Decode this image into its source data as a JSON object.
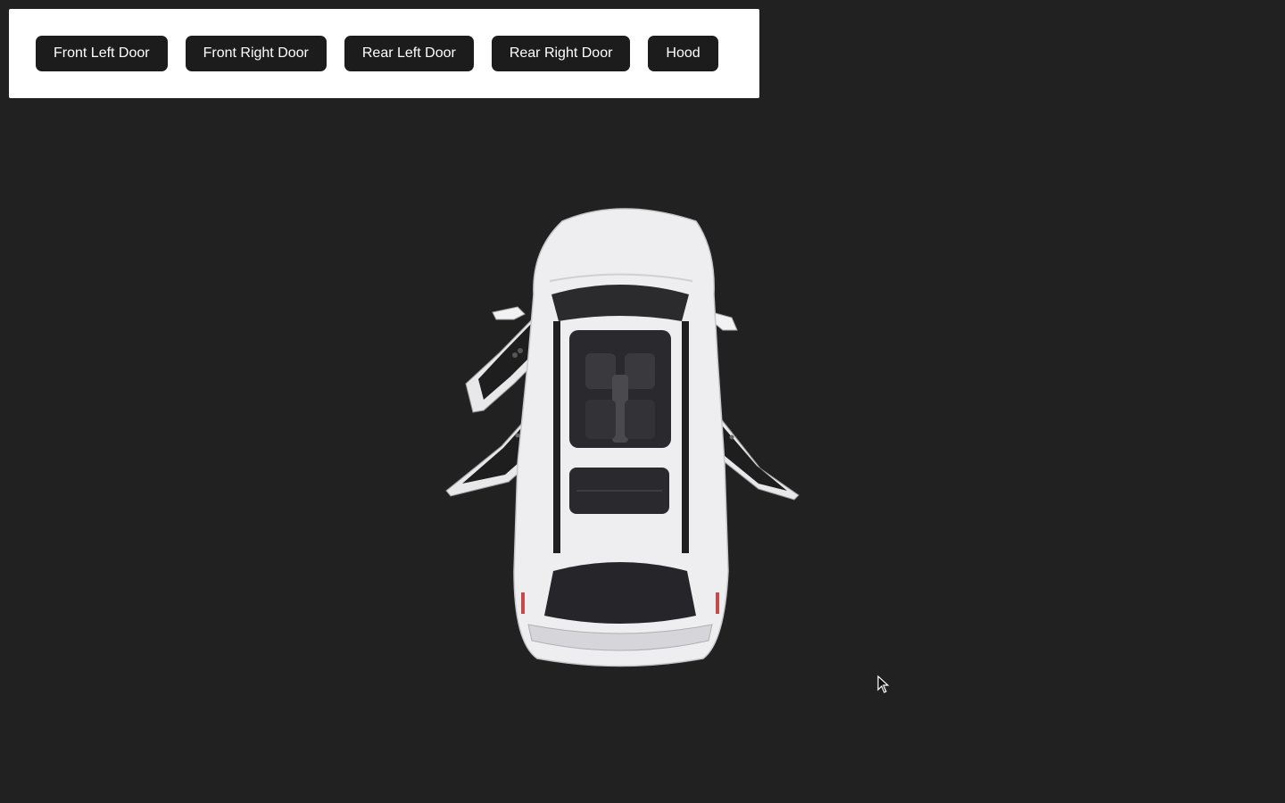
{
  "controls": {
    "buttons": [
      {
        "label": "Front Left Door"
      },
      {
        "label": "Front Right Door"
      },
      {
        "label": "Rear Left Door"
      },
      {
        "label": "Rear Right Door"
      },
      {
        "label": "Hood"
      }
    ]
  },
  "scene": {
    "background_color": "#212121",
    "model": "suv-top-view",
    "doors_open": [
      "front-left",
      "rear-left",
      "front-right"
    ],
    "car_color": "#f0f0f2"
  },
  "cursor": {
    "icon": "pointer-cursor-icon"
  }
}
